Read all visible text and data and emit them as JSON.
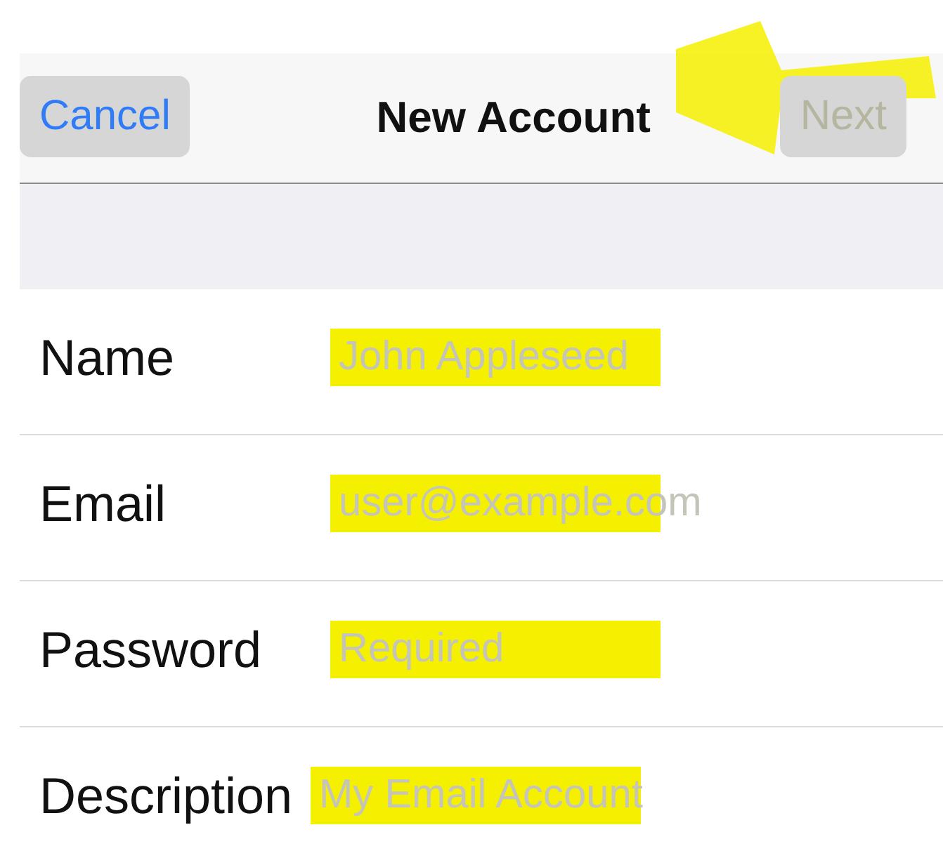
{
  "nav_bar": {
    "cancel": {
      "label": "Cancel"
    },
    "title": "New Account",
    "next": {
      "label": "Next",
      "disabled": true,
      "highlighted": true
    }
  },
  "fields": [
    {
      "label": "Name",
      "placeholder": "John Appleseed",
      "highlighted": true
    },
    {
      "label": "Email",
      "placeholder": "user@example.com",
      "highlighted": true
    },
    {
      "label": "Password",
      "placeholder": "Required",
      "highlighted": true
    },
    {
      "label": "Description",
      "placeholder": "My Email Account",
      "highlighted": true
    }
  ]
}
